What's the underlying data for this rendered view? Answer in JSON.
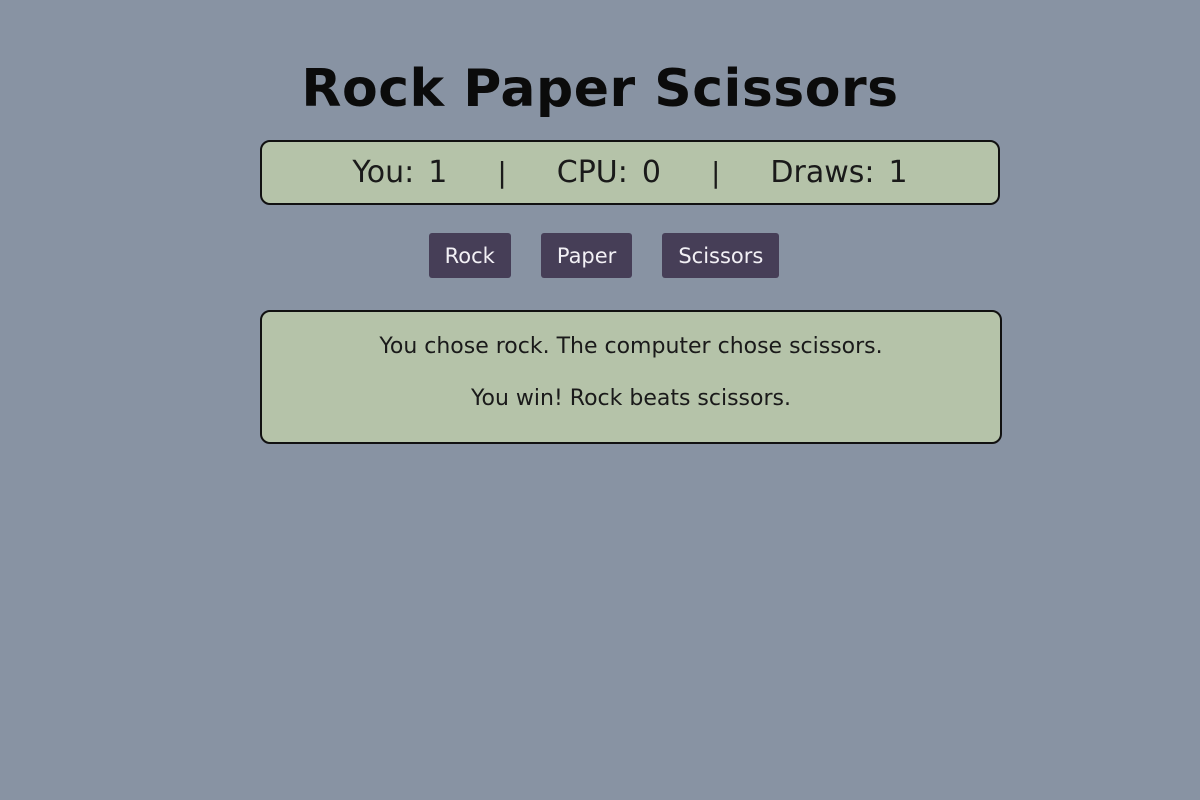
{
  "title": "Rock Paper Scissors",
  "score": {
    "you_label": "You:",
    "you_value": "1",
    "cpu_label": "CPU:",
    "cpu_value": "0",
    "draws_label": "Draws:",
    "draws_value": "1",
    "separator": "|"
  },
  "buttons": {
    "rock": "Rock",
    "paper": "Paper",
    "scissors": "Scissors"
  },
  "result": {
    "choice_text": "You chose rock. The computer chose scissors.",
    "outcome_text": "You win! Rock beats scissors."
  },
  "colors": {
    "background": "#8893a3",
    "panel": "#b5c3a9",
    "button": "#463e57",
    "button_text": "#f2f0f5",
    "border": "#111111"
  }
}
